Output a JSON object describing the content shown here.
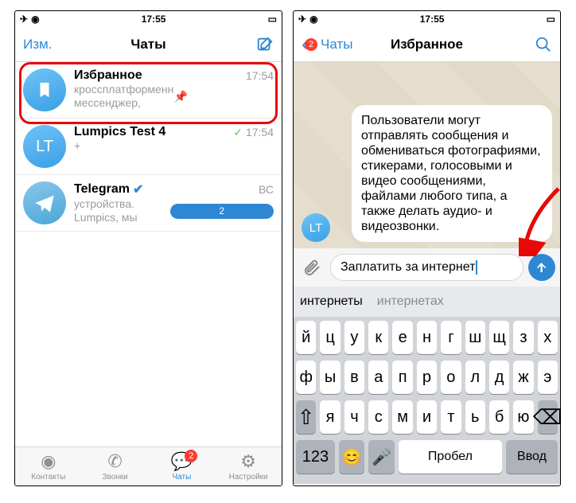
{
  "statusbar": {
    "time": "17:55"
  },
  "left": {
    "nav": {
      "edit": "Изм.",
      "title": "Чаты"
    },
    "chats": [
      {
        "name": "Избранное",
        "time": "17:54",
        "preview": "Telegram — кроссплатформенный мессенджер, позво...",
        "avatar_letters": "",
        "pinned": true
      },
      {
        "name": "Lumpics Test 4",
        "time": "17:54",
        "preview": "+",
        "avatar_letters": "LT",
        "checked": true
      },
      {
        "name": "Telegram",
        "time": "ВС",
        "preview": "Вход с нового устройства. Lumpics, мы обнаружили в...",
        "badge": "2",
        "verified": true
      }
    ],
    "tabs": {
      "contacts": "Контакты",
      "calls": "Звонки",
      "chats": "Чаты",
      "chats_badge": "2",
      "settings": "Настройки"
    }
  },
  "right": {
    "nav": {
      "back": "Чаты",
      "back_badge": "2",
      "title": "Избранное"
    },
    "bubble_text": "Пользователи могут отправлять сообщения и обмениваться фотографиями, стикерами, голосовыми и видео сообщениями, файлами любого типа, а также делать аудио- и видеозвонки.",
    "mini_avatar": "LT",
    "compose_value": "Заплатить за интернет",
    "suggestions": [
      "интернеты",
      "интернетах"
    ],
    "keyboard": {
      "row1": [
        "й",
        "ц",
        "у",
        "к",
        "е",
        "н",
        "г",
        "ш",
        "щ",
        "з",
        "х"
      ],
      "row2": [
        "ф",
        "ы",
        "в",
        "а",
        "п",
        "р",
        "о",
        "л",
        "д",
        "ж",
        "э"
      ],
      "row3_shift": "⇧",
      "row3": [
        "я",
        "ч",
        "с",
        "м",
        "и",
        "т",
        "ь",
        "б",
        "ю"
      ],
      "row3_back": "⌫",
      "row4": {
        "num": "123",
        "emoji": "😊",
        "mic": "🎤",
        "space": "Пробел",
        "enter": "Ввод"
      }
    }
  }
}
